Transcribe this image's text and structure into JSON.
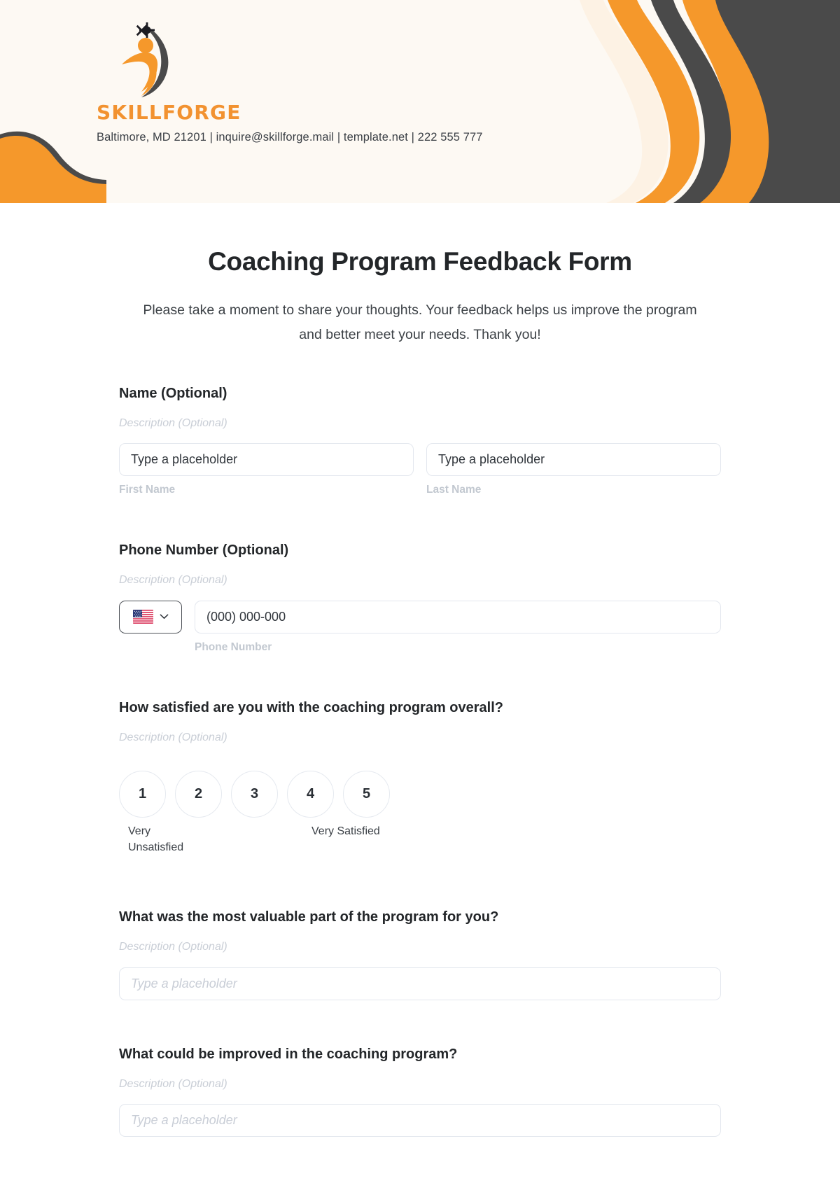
{
  "header": {
    "brand_name": "SKILLFORGE",
    "contact_line": "Baltimore, MD 21201 | inquire@skillforge.mail | template.net | 222 555 777",
    "colors": {
      "orange": "#F5982B",
      "dark": "#4A4A4A",
      "cream": "#FDF2E4",
      "bg": "#FDF9F3"
    }
  },
  "form": {
    "title": "Coaching Program Feedback Form",
    "subtitle": "Please take a moment to share your thoughts. Your feedback helps us improve the program and better meet your needs. Thank you!",
    "description_placeholder": "Description (Optional)",
    "fields": {
      "name": {
        "label": "Name (Optional)",
        "description": "Description (Optional)",
        "first": {
          "placeholder": "Type a placeholder",
          "value": "",
          "helper": "First Name"
        },
        "last": {
          "placeholder": "Type a placeholder",
          "value": "",
          "helper": "Last Name"
        }
      },
      "phone": {
        "label": "Phone Number (Optional)",
        "description": "Description (Optional)",
        "country": {
          "flag": "us-flag-icon",
          "chevron": "chevron-down-icon"
        },
        "input": {
          "placeholder": "(000) 000-000",
          "value": "",
          "helper": "Phone Number"
        }
      },
      "satisfaction": {
        "label": "How satisfied are you with the coaching program overall?",
        "description": "Description (Optional)",
        "options": [
          "1",
          "2",
          "3",
          "4",
          "5"
        ],
        "low_label": "Very Unsatisfied",
        "high_label": "Very Satisfied",
        "selected": null
      },
      "valuable": {
        "label": "What was the most valuable part of the program for you?",
        "description": "Description (Optional)",
        "input": {
          "placeholder": "Type a placeholder",
          "value": ""
        }
      },
      "improve": {
        "label": "What could be improved in the coaching program?",
        "description": "Description (Optional)",
        "input": {
          "placeholder": "Type a placeholder",
          "value": ""
        }
      }
    }
  }
}
